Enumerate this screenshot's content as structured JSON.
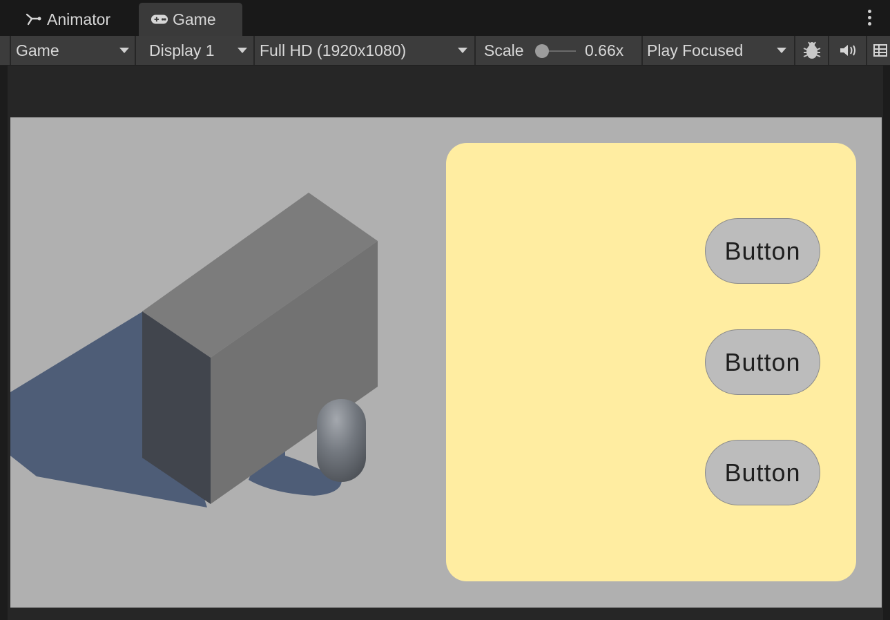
{
  "tabs": [
    {
      "label": "Animator",
      "icon": "animator-icon"
    },
    {
      "label": "Game",
      "icon": "gamepad-icon",
      "active": true
    }
  ],
  "toolbar": {
    "view_select": "Game",
    "display_select": "Display 1",
    "resolution_select": "Full HD (1920x1080)",
    "scale_label": "Scale",
    "scale_value": "0.66x",
    "play_mode_select": "Play Focused",
    "icons": [
      "bug-icon",
      "audio-mute-icon",
      "stats-grid-icon"
    ]
  },
  "game_view": {
    "background_color": "#b0b0b0",
    "panel_color": "#ffeda1",
    "buttons": [
      {
        "label": "Button"
      },
      {
        "label": "Button"
      },
      {
        "label": "Button"
      }
    ]
  }
}
